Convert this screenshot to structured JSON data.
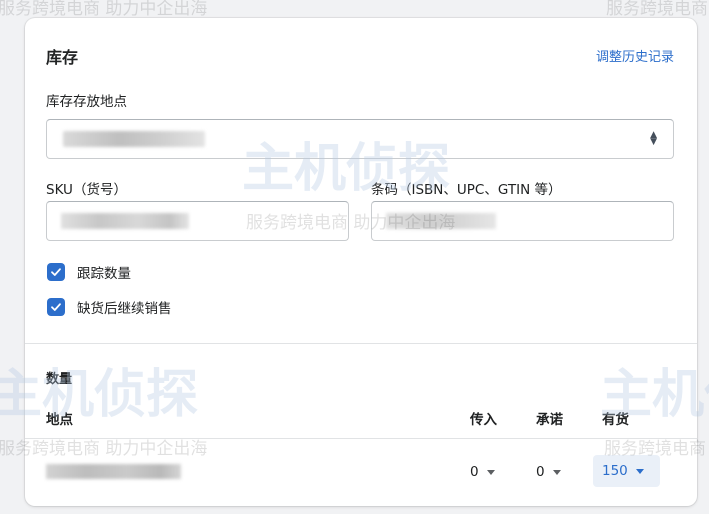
{
  "card": {
    "title": "库存",
    "history_link": "调整历史记录"
  },
  "location_field": {
    "label": "库存存放地点",
    "value": ""
  },
  "sku_field": {
    "label": "SKU（货号）",
    "value": ""
  },
  "barcode_field": {
    "label": "条码（ISBN、UPC、GTIN 等）",
    "value": ""
  },
  "checkboxes": [
    {
      "label": "跟踪数量",
      "checked": true
    },
    {
      "label": "缺货后继续销售",
      "checked": true
    }
  ],
  "quantity": {
    "title": "数量",
    "columns": [
      "地点",
      "传入",
      "承诺",
      "有货"
    ],
    "rows": [
      {
        "location": "",
        "incoming": "0",
        "committed": "0",
        "available": "150"
      }
    ]
  },
  "watermark": {
    "brand": "主机侦探",
    "slogan": "服务跨境电商 助力中企出海"
  },
  "colors": {
    "accent": "#2c6ecb",
    "border": "#c9cccf",
    "text": "#202223"
  },
  "icons": {
    "select_arrows": "select-updown-icon",
    "checkbox": "checkmark-icon",
    "dropdown": "caret-down-icon"
  }
}
